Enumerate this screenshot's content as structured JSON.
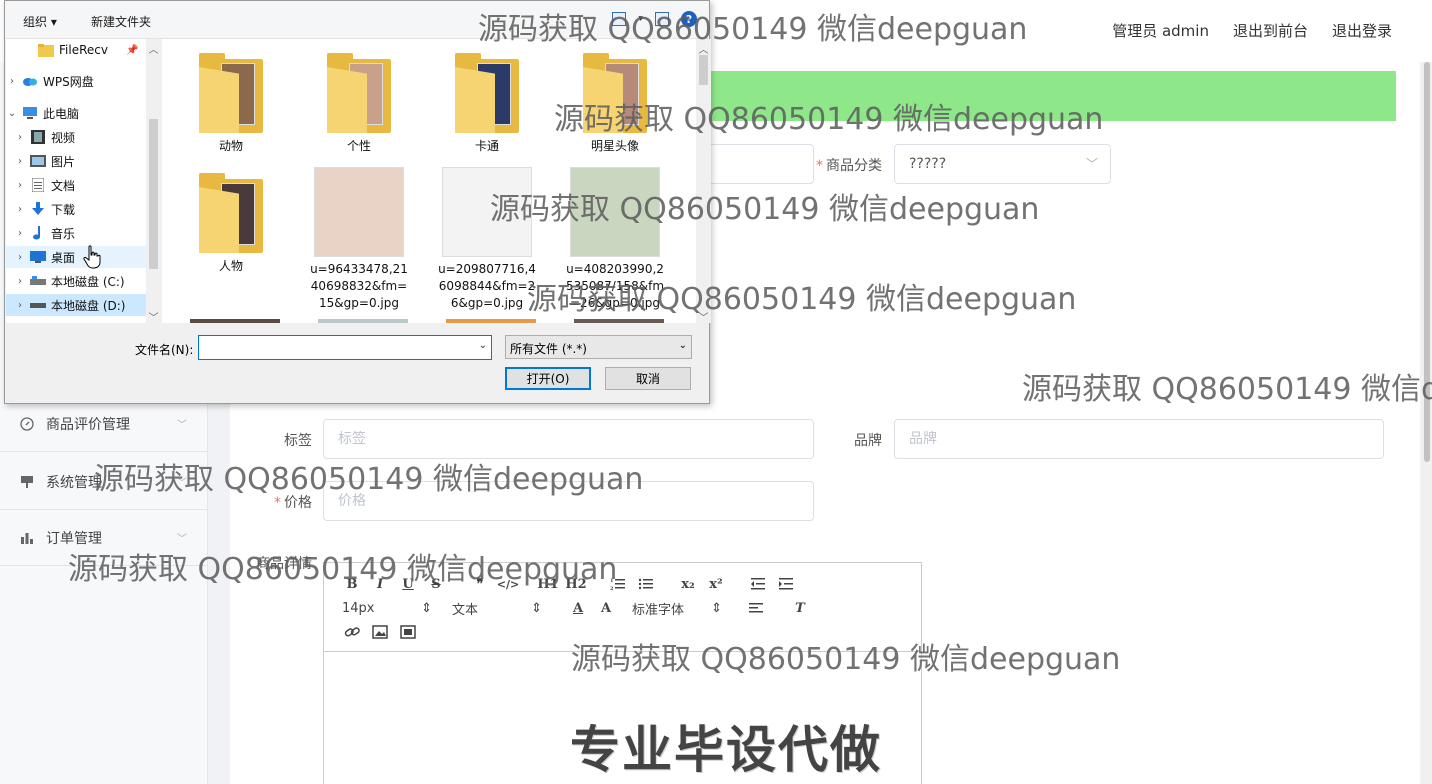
{
  "topbar": {
    "admin_label": "管理员 admin",
    "exit_front": "退出到前台",
    "logout": "退出登录"
  },
  "sidebar": {
    "items": [
      {
        "label": "商品评价管理",
        "icon": "compass-icon"
      },
      {
        "label": "系统管理",
        "icon": "monitor-icon"
      },
      {
        "label": "订单管理",
        "icon": "bar-chart-icon"
      }
    ]
  },
  "form": {
    "category_label": "商品分类",
    "category_value": "?????",
    "tag_label": "标签",
    "tag_placeholder": "标签",
    "brand_label": "品牌",
    "brand_placeholder": "品牌",
    "price_label": "价格",
    "price_placeholder": "价格",
    "detail_label": "商品详情"
  },
  "editor": {
    "toolbar_row1": [
      "B",
      "I",
      "U",
      "S",
      "❞",
      "</>",
      "H1",
      "H2",
      "ol",
      "ul",
      "x₂",
      "x²",
      "outdent",
      "indent"
    ],
    "font_size": "14px",
    "text_style": "文本",
    "font_family": "标准字体",
    "content_text": "专业毕设代做"
  },
  "watermark": "源码获取 QQ86050149 微信deepguan",
  "dialog": {
    "toolbar": {
      "organize": "组织 ▾",
      "new_folder": "新建文件夹"
    },
    "nav": [
      {
        "label": "FileRecv",
        "icon": "folder-icon",
        "pinned": true
      },
      {
        "label": "WPS网盘",
        "icon": "cloud-icon"
      },
      {
        "label": "此电脑",
        "icon": "computer-icon",
        "expanded": true
      },
      {
        "label": "视频",
        "icon": "video-icon"
      },
      {
        "label": "图片",
        "icon": "picture-icon"
      },
      {
        "label": "文档",
        "icon": "document-icon"
      },
      {
        "label": "下载",
        "icon": "download-icon"
      },
      {
        "label": "音乐",
        "icon": "music-icon"
      },
      {
        "label": "桌面",
        "icon": "desktop-icon",
        "hovered": true
      },
      {
        "label": "本地磁盘 (C:)",
        "icon": "drive-icon"
      },
      {
        "label": "本地磁盘 (D:)",
        "icon": "drive-icon",
        "selected": true
      }
    ],
    "files": [
      {
        "name": "动物",
        "type": "folder",
        "color": "#8a6a4a"
      },
      {
        "name": "个性",
        "type": "folder",
        "color": "#c9a08a"
      },
      {
        "name": "卡通",
        "type": "folder",
        "color": "#2b3a66"
      },
      {
        "name": "明星头像",
        "type": "folder",
        "color": "#b58a78"
      },
      {
        "name": "人物",
        "type": "folder",
        "color": "#4a3a3a"
      },
      {
        "name": "u=96433478,2140698832&fm=15&gp=0.jpg",
        "type": "image",
        "color": "#e9d2c6"
      },
      {
        "name": "u=209807716,46098844&fm=26&gp=0.jpg",
        "type": "image",
        "color": "#f3f3f3"
      },
      {
        "name": "u=408203990,2535087/158&fm=26&gp=0.jpg",
        "type": "image",
        "color": "#c9d7c0"
      }
    ],
    "file_lines": [
      [
        "动物"
      ],
      [
        "个性"
      ],
      [
        "卡通"
      ],
      [
        "明星头像"
      ],
      [
        "人物"
      ],
      [
        "u=96433478,21",
        "40698832&fm=",
        "15&gp=0.jpg"
      ],
      [
        "u=209807716,4",
        "6098844&fm=2",
        "6&gp=0.jpg"
      ],
      [
        "u=408203990,2",
        "535087/158&fm",
        "=26&gp=0.jpg"
      ]
    ],
    "filename_label": "文件名(N):",
    "filename_value": "",
    "filetype_value": "所有文件 (*.*)",
    "open_button": "打开(O)",
    "cancel_button": "取消"
  }
}
